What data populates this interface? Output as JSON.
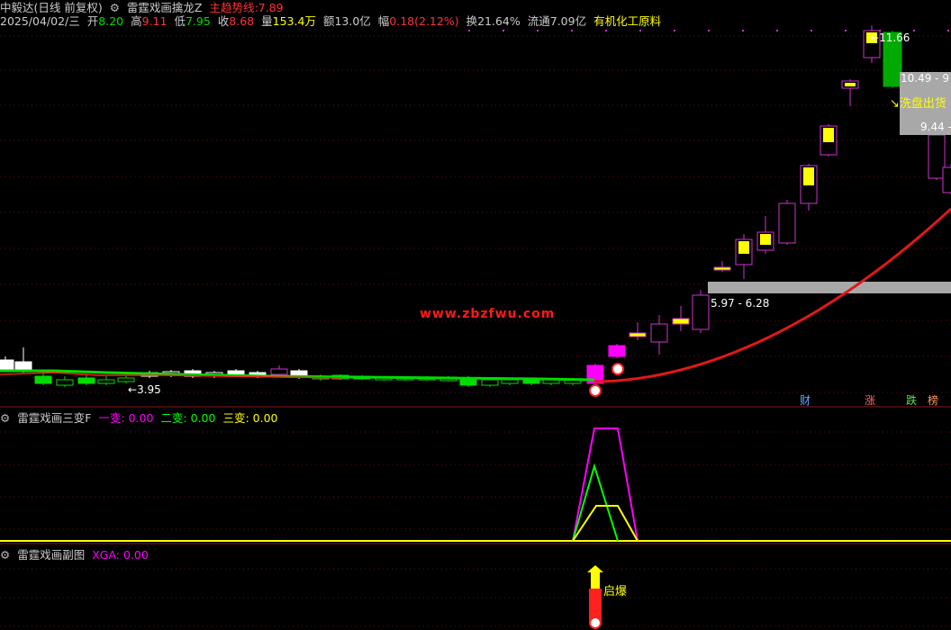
{
  "colors": {
    "up": "#ff3232",
    "down": "#00dd00",
    "purple": "#cc33cc",
    "magenta": "#ff00ff",
    "yellow": "#ffff00",
    "white": "#ffffff",
    "green": "#00ff00",
    "gray": "#999999",
    "trend": "#e01818",
    "cyan": "#00ffff"
  },
  "main_header": {
    "stock": "中毅达(日线 前复权)",
    "indicator": "雷霆戏画擒龙Z",
    "trend_label": "主趋势线:",
    "trend_value": "7.89"
  },
  "quote": {
    "date": "2025/04/02/三",
    "open_label": "开",
    "open": "8.20",
    "high_label": "高",
    "high": "9.11",
    "low_label": "低",
    "low": "7.95",
    "close_label": "收",
    "close": "8.68",
    "vol_label": "量",
    "vol": "153.4万",
    "amount_label": "额",
    "amount": "13.0亿",
    "change_label": "幅",
    "change": "0.18(2.12%)",
    "turnover_label": "换",
    "turnover": "21.64%",
    "float_label": "流通",
    "float": "7.09亿",
    "sector": "有机化工原料"
  },
  "annotations": {
    "high_marker": "11.66",
    "low_marker": "3.95",
    "zone_label_1": "5.97 - 6.28",
    "zone_label_2": "10.49 - 9",
    "zone_label_3": "9.44 -",
    "signal_label": "洗盘出货",
    "burst_label": "启爆",
    "watermark": "www.zbzfwu.com"
  },
  "tags": {
    "fin": "财",
    "up": "涨",
    "down": "跌",
    "rank": "榜"
  },
  "panel2": {
    "name": "雷霆戏画三变F",
    "l1": "一变:",
    "v1": "0.00",
    "l2": "二变:",
    "v2": "0.00",
    "l3": "三变:",
    "v3": "0.00"
  },
  "panel3": {
    "name": "雷霆戏画副图",
    "label": "XGA:",
    "value": "0.00"
  }
}
